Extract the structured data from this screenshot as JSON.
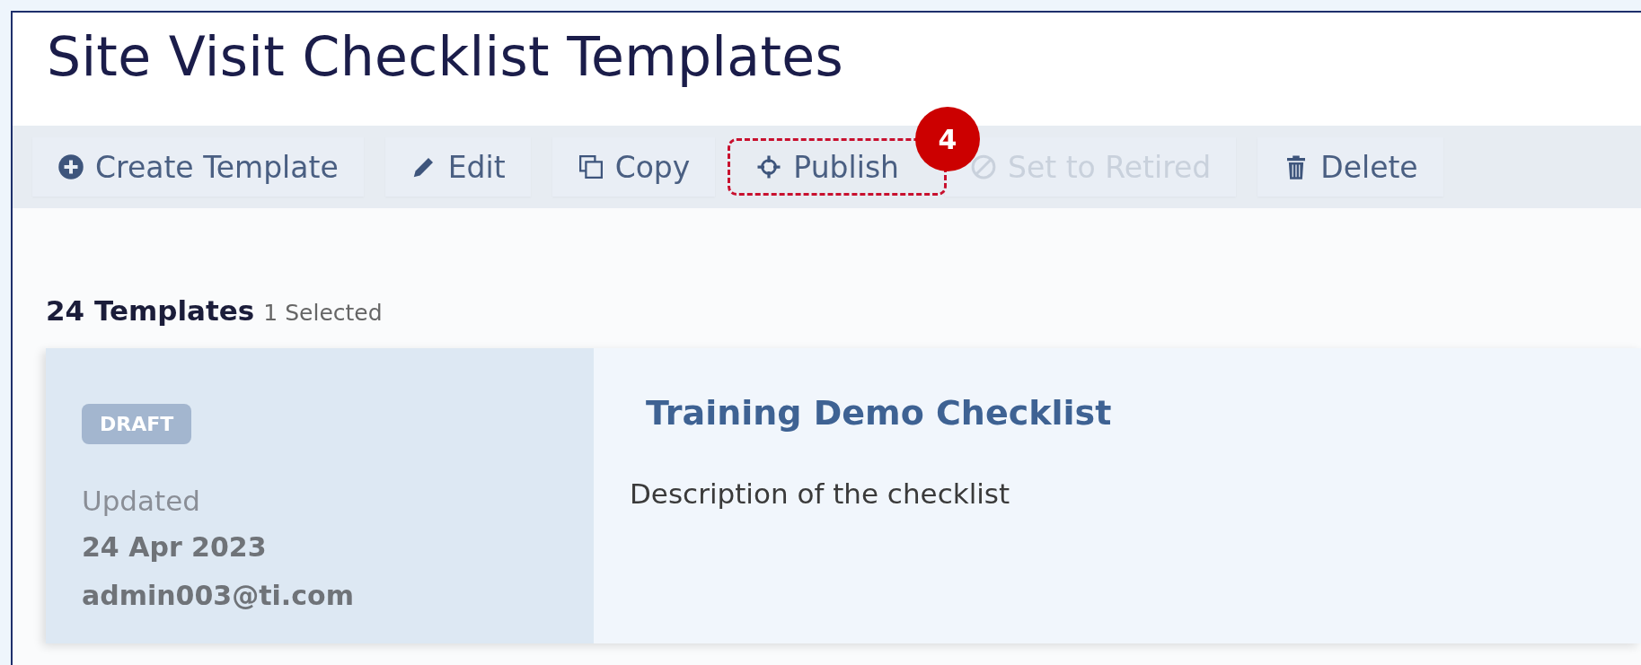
{
  "page": {
    "title": "Site Visit Checklist Templates"
  },
  "toolbar": [
    {
      "label": "Create Template",
      "disabled": false
    },
    {
      "label": "Edit",
      "disabled": false
    },
    {
      "label": "Copy",
      "disabled": false
    },
    {
      "label": "Publish",
      "disabled": false,
      "callout": "4"
    },
    {
      "label": "Set to Retired",
      "disabled": true
    },
    {
      "label": "Delete",
      "disabled": false
    }
  ],
  "summary": {
    "count": "24 Templates",
    "selected": "1 Selected"
  },
  "templates": [
    {
      "status": "DRAFT",
      "updated_label": "Updated",
      "date": "24 Apr 2023",
      "author": "admin003@ti.com",
      "title": "Training Demo Checklist",
      "description": "Description of the checklist"
    }
  ]
}
